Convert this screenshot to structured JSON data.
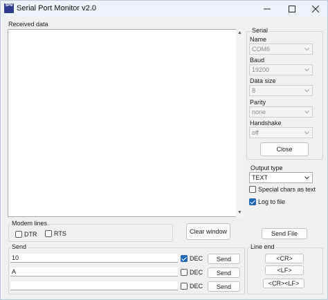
{
  "window": {
    "title": "Serial Port Monitor v2.0",
    "app_icon_text": "SPM"
  },
  "received": {
    "label": "Received data"
  },
  "serial": {
    "group_label": "Serial",
    "name_label": "Name",
    "name_value": "COM6",
    "baud_label": "Baud",
    "baud_value": "19200",
    "data_size_label": "Data size",
    "data_size_value": "8",
    "parity_label": "Parity",
    "parity_value": "none",
    "handshake_label": "Handshake",
    "handshake_value": "off",
    "close_label": "Close"
  },
  "output": {
    "type_label": "Output type",
    "type_value": "TEXT",
    "special_chars_label": "Special chars as text",
    "special_chars_checked": false,
    "log_label": "Log to file",
    "log_checked": true
  },
  "modem": {
    "group_label": "Modem lines",
    "dtr_label": "DTR",
    "dtr_checked": false,
    "rts_label": "RTS",
    "rts_checked": false
  },
  "clear_window_label": "Clear window",
  "send_file_label": "Send File",
  "send": {
    "group_label": "Send",
    "rows": [
      {
        "value": "10",
        "dec_checked": true,
        "dec_label": "DEC",
        "button_label": "Send"
      },
      {
        "value": "A",
        "dec_checked": false,
        "dec_label": "DEC",
        "button_label": "Send"
      },
      {
        "value": "",
        "dec_checked": false,
        "dec_label": "DEC",
        "button_label": "Send"
      }
    ]
  },
  "line_end": {
    "group_label": "Line end",
    "cr_label": "<CR>",
    "lf_label": "<LF>",
    "crlf_label": "<CR><LF>"
  },
  "colors": {
    "accent": "#2067b8",
    "window_bg": "#f0f0f0",
    "titlebar_bg": "#eef3fa"
  }
}
